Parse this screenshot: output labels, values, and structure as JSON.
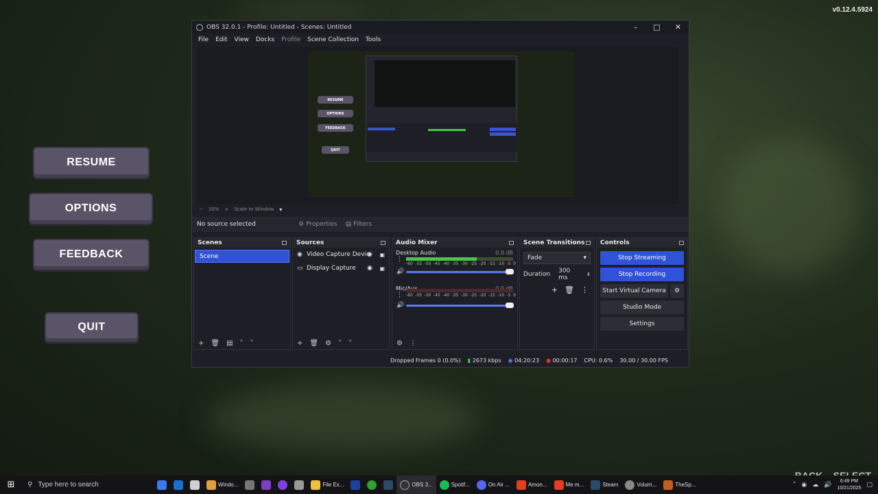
{
  "version": "v0.12.4.5924",
  "game_menu": {
    "resume": "RESUME",
    "options": "OPTIONS",
    "feedback": "FEEDBACK",
    "quit": "QUIT"
  },
  "obs": {
    "title": "OBS 32.0.1 - Profile: Untitled - Scenes: Untitled",
    "menu": [
      "File",
      "Edit",
      "View",
      "Docks",
      "Profile",
      "Scene Collection",
      "Tools"
    ],
    "zoom": {
      "level": "30%",
      "mode": "Scale to Window"
    },
    "toolbar": {
      "no_source": "No source selected",
      "properties": "Properties",
      "filters": "Filters"
    },
    "preview_mini": {
      "resume": "RESUME",
      "options": "OPTIONS",
      "feedback": "FEEDBACK",
      "quit": "QUIT"
    },
    "scenes": {
      "header": "Scenes",
      "items": [
        "Scene"
      ]
    },
    "sources": {
      "header": "Sources",
      "items": [
        "Video Capture Devic",
        "Display Capture"
      ]
    },
    "audio_mixer": {
      "header": "Audio Mixer",
      "channels": [
        {
          "name": "Desktop Audio",
          "db": "0.0 dB",
          "level": 0.66
        },
        {
          "name": "Mic/Aux",
          "db": "0.0 dB",
          "level": 0.0
        }
      ],
      "ticks": [
        "-60",
        "-55",
        "-50",
        "-45",
        "-40",
        "-35",
        "-30",
        "-25",
        "-20",
        "-15",
        "-10",
        "-5",
        "0"
      ]
    },
    "scene_transitions": {
      "header": "Scene Transitions",
      "transition": "Fade",
      "duration_label": "Duration",
      "duration_value": "300 ms"
    },
    "controls": {
      "header": "Controls",
      "stop_streaming": "Stop Streaming",
      "stop_recording": "Stop Recording",
      "start_virtual_camera": "Start Virtual Camera",
      "studio_mode": "Studio Mode",
      "settings": "Settings"
    },
    "status": {
      "dropped": "Dropped Frames 0 (0.0%)",
      "bitrate": "2673 kbps",
      "stream_time": "04:20:23",
      "rec_time": "00:00:17",
      "cpu": "CPU: 0.6%",
      "fps": "30.00 / 30.00 FPS"
    }
  },
  "taskbar": {
    "search_placeholder": "Type here to search",
    "apps": [
      "Windo...",
      "File Ex...",
      "OBS 3...",
      "Spotif...",
      "On Air ...",
      "Amon...",
      "Me m...",
      "Steam",
      "Volum...",
      "TheSp..."
    ],
    "time": "6:49 PM",
    "date": "10/21/2025"
  },
  "overlay_hints": {
    "back": "BACK",
    "select": "SELECT"
  },
  "colors": {
    "accent_blue": "#2f52d6",
    "menu_button": "#5a5468",
    "meter_green": "#46c846",
    "record_red": "#e03030"
  }
}
